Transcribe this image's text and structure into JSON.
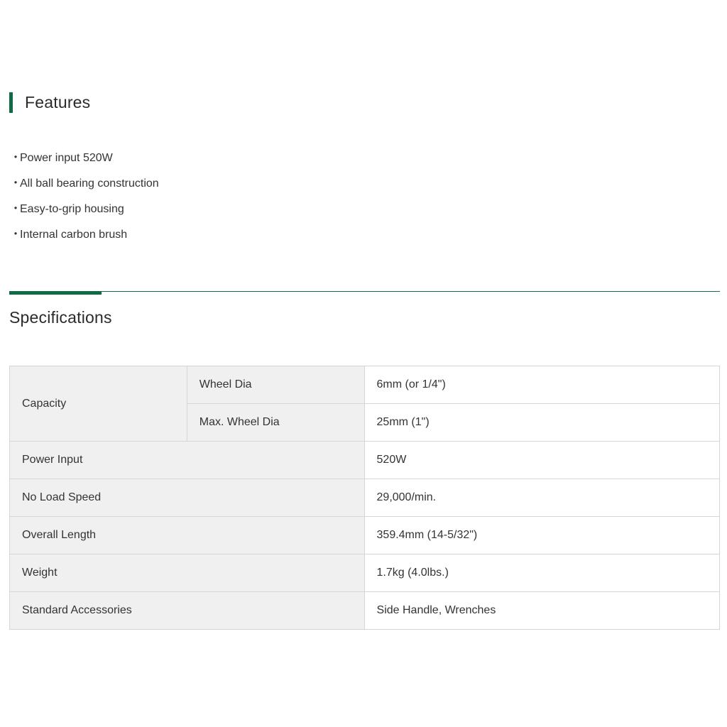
{
  "features": {
    "title": "Features",
    "bullet": "・",
    "items": [
      "Power input 520W",
      "All ball bearing construction",
      "Easy-to-grip housing",
      "Internal carbon brush"
    ]
  },
  "specifications": {
    "title": "Specifications",
    "capacity": {
      "label": "Capacity",
      "wheel_dia_label": "Wheel Dia",
      "wheel_dia_value": "6mm (or 1/4\")",
      "max_wheel_dia_label": "Max. Wheel Dia",
      "max_wheel_dia_value": "25mm (1\")"
    },
    "rows": [
      {
        "label": "Power Input",
        "value": "520W"
      },
      {
        "label": "No Load Speed",
        "value": "29,000/min."
      },
      {
        "label": "Overall Length",
        "value": "359.4mm (14-5/32\")"
      },
      {
        "label": "Weight",
        "value": "1.7kg (4.0lbs.)"
      },
      {
        "label": "Standard Accessories",
        "value": "Side Handle, Wrenches"
      }
    ]
  },
  "colors": {
    "accent": "#0e6b46",
    "label_bg": "#f0f0f0",
    "border": "#d6d6d6"
  }
}
